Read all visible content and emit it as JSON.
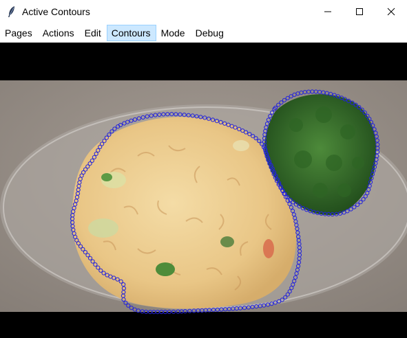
{
  "window": {
    "title": "Active Contours",
    "app_icon": "feather-icon",
    "controls": [
      "minimize-icon",
      "maximize-icon",
      "close-icon"
    ]
  },
  "menu": {
    "items": [
      {
        "label": "Pages",
        "active": false
      },
      {
        "label": "Actions",
        "active": false
      },
      {
        "label": "Edit",
        "active": false
      },
      {
        "label": "Contours",
        "active": true
      },
      {
        "label": "Mode",
        "active": false
      },
      {
        "label": "Debug",
        "active": false
      }
    ]
  },
  "canvas": {
    "background": "#000000",
    "contour_color": "#2222dd"
  }
}
